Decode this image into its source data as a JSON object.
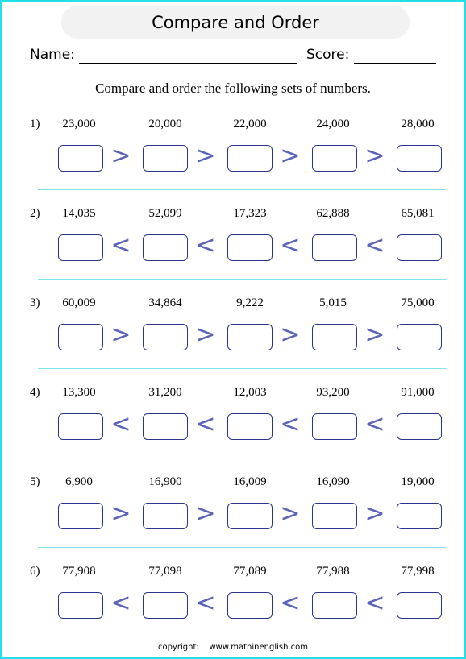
{
  "title": "Compare and Order",
  "name_label": "Name:",
  "score_label": "Score:",
  "instructions": "Compare and order the following sets of numbers.",
  "problems": [
    {
      "label": "1)",
      "numbers": [
        "23,000",
        "20,000",
        "22,000",
        "24,000",
        "28,000"
      ],
      "operator": ">"
    },
    {
      "label": "2)",
      "numbers": [
        "14,035",
        "52,099",
        "17,323",
        "62,888",
        "65,081"
      ],
      "operator": "<"
    },
    {
      "label": "3)",
      "numbers": [
        "60,009",
        "34,864",
        "9,222",
        "5,015",
        "75,000"
      ],
      "operator": ">"
    },
    {
      "label": "4)",
      "numbers": [
        "13,300",
        "31,200",
        "12,003",
        "93,200",
        "91,000"
      ],
      "operator": "<"
    },
    {
      "label": "5)",
      "numbers": [
        "6,900",
        "16,900",
        "16,009",
        "16,090",
        "19,000"
      ],
      "operator": ">"
    },
    {
      "label": "6)",
      "numbers": [
        "77,908",
        "77,098",
        "77,089",
        "77,988",
        "77,998"
      ],
      "operator": "<"
    }
  ],
  "footer": {
    "copyright_label": "copyright:",
    "site": "www.mathinenglish.com"
  },
  "colors": {
    "border": "#22e0e6",
    "box_outline": "#2b3590",
    "operator": "#5a63b8",
    "separator": "#7ee3ee",
    "title_bg": "#f2f2f2"
  }
}
